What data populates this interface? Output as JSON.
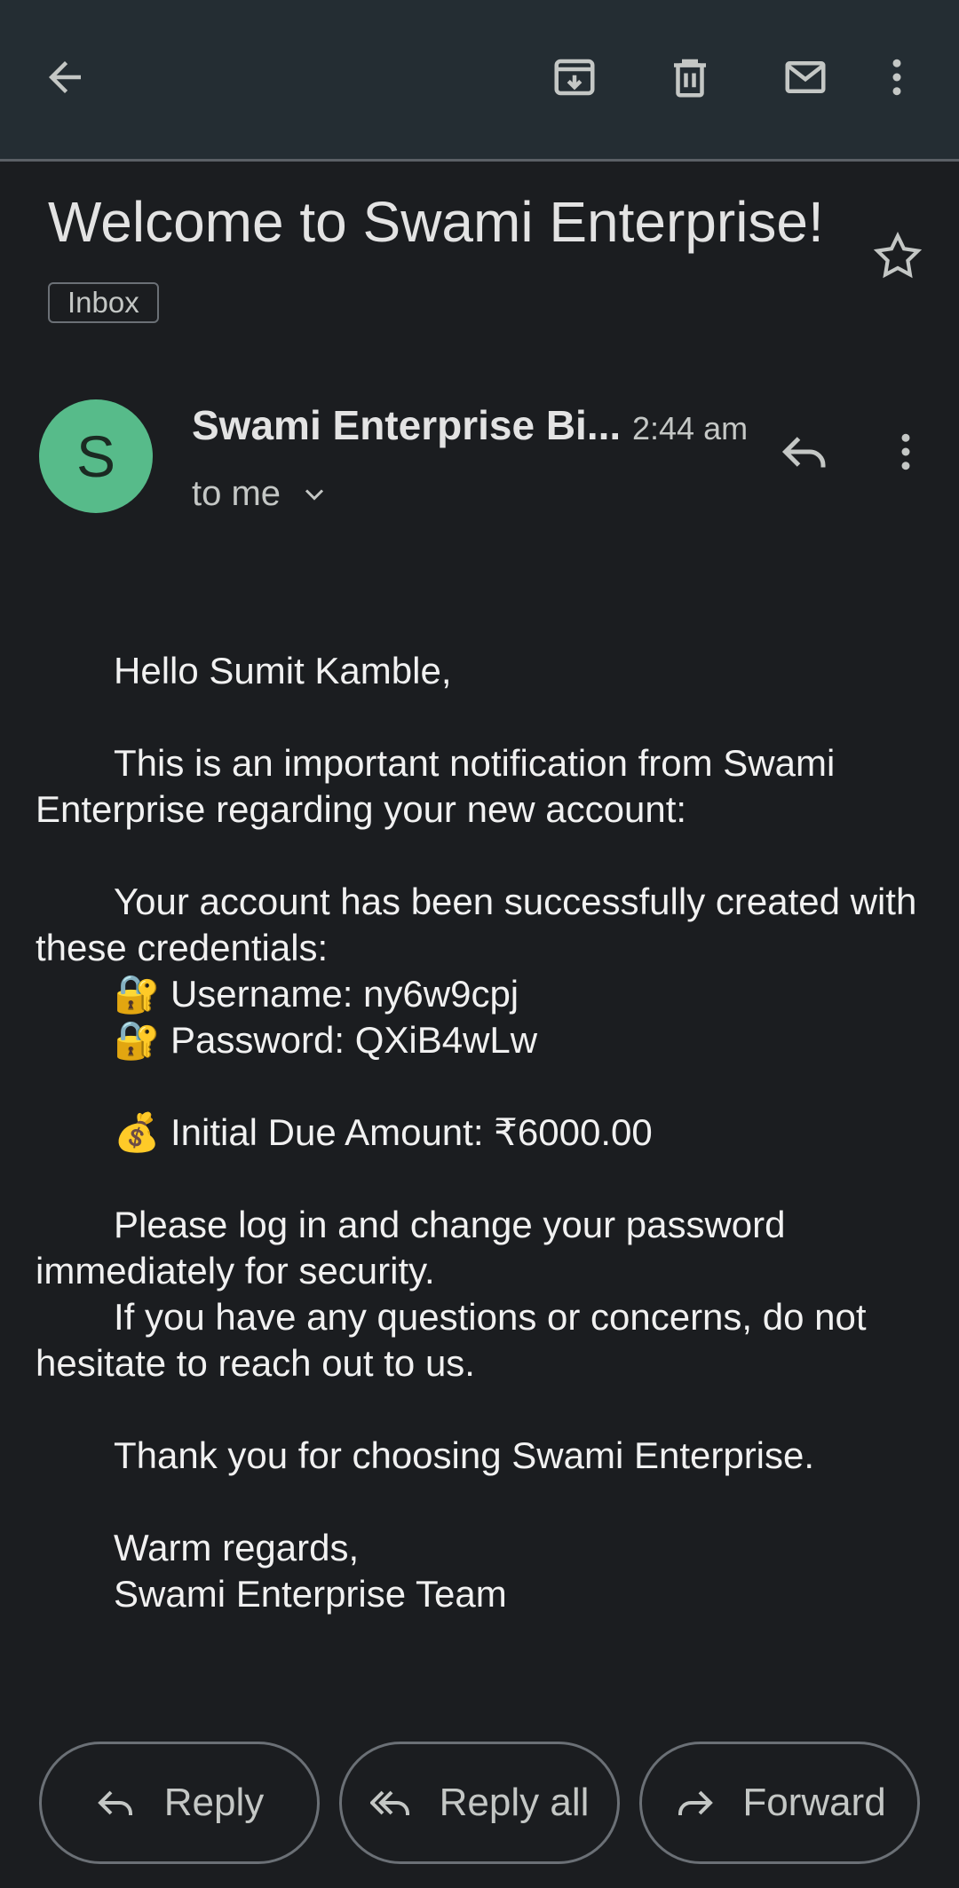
{
  "toolbar": {
    "icons": [
      "back-arrow-icon",
      "archive-icon",
      "delete-icon",
      "mark-unread-icon",
      "more-vert-icon"
    ]
  },
  "email": {
    "subject": "Welcome to Swami Enterprise!",
    "label": "Inbox",
    "sender_initial": "S",
    "sender": "Swami Enterprise Bi...",
    "time": "2:44 am",
    "recipient": "to me",
    "body": {
      "greeting": "Hello Sumit Kamble,",
      "para1": "This is an important notification from Swami Enterprise regarding your new account:",
      "para2": "Your account has been successfully created with these credentials:",
      "username_line": "🔐 Username: ny6w9cpj",
      "password_line": "🔐 Password: QXiB4wLw",
      "due_line": "💰 Initial Due Amount: ₹6000.00",
      "para3": "Please log in and change your password immediately for security.",
      "para4": "If you have any questions or concerns, do not hesitate to reach out to us.",
      "thanks": "Thank you for choosing Swami Enterprise.",
      "closing": "Warm regards,",
      "signature": "Swami Enterprise Team"
    }
  },
  "actions": {
    "reply": "Reply",
    "reply_all": "Reply all",
    "forward": "Forward"
  },
  "colors": {
    "background": "#1b1d20",
    "toolbar": "#242d33",
    "avatar": "#57bb8a"
  }
}
